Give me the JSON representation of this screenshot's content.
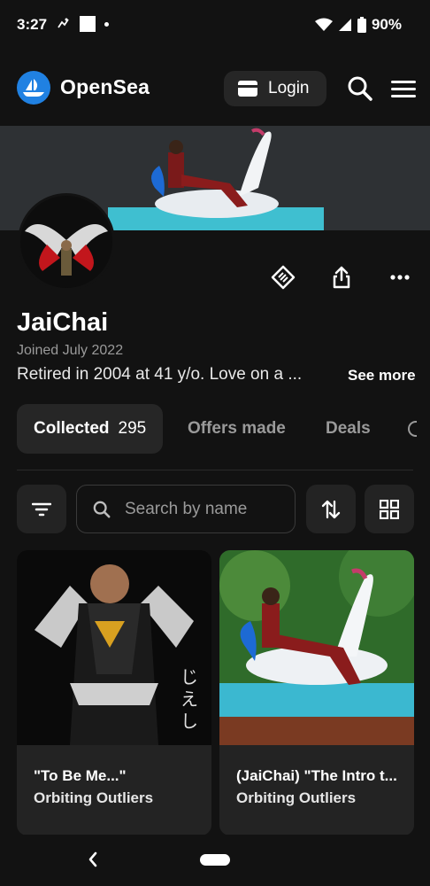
{
  "status_bar": {
    "time": "3:27",
    "battery": "90%",
    "icons": [
      "activity-icon",
      "square-notification-icon",
      "dot-icon",
      "wifi-icon",
      "signal-icon",
      "battery-icon"
    ]
  },
  "header": {
    "brand": "OpenSea",
    "login_label": "Login",
    "brand_color": "#2081e2"
  },
  "profile": {
    "name": "JaiChai",
    "joined": "Joined July 2022",
    "bio": "Retired in 2004 at 41 y/o. Love on a ...",
    "see_more": "See more"
  },
  "tabs": [
    {
      "label": "Collected",
      "count": "295",
      "active": true
    },
    {
      "label": "Offers made",
      "active": false
    },
    {
      "label": "Deals",
      "active": false
    }
  ],
  "search": {
    "placeholder": "Search by name"
  },
  "cards": [
    {
      "title": "\"To Be Me...\"",
      "collection": "Orbiting Outliers"
    },
    {
      "title": "(JaiChai) \"The Intro t...",
      "collection": "Orbiting Outliers"
    }
  ],
  "colors": {
    "background": "#121212",
    "surface": "#232323",
    "muted_text": "#9a9a9a"
  }
}
